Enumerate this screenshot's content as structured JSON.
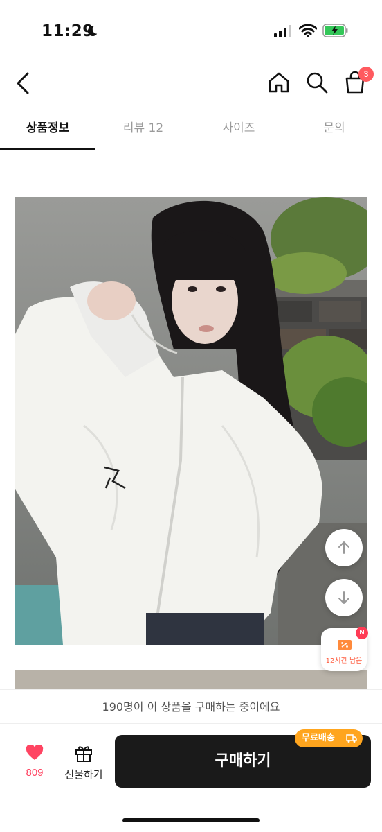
{
  "status_bar": {
    "time": "11:29"
  },
  "header": {
    "cart_count": "3"
  },
  "tabs": [
    {
      "label": "상품정보",
      "active": true
    },
    {
      "label": "리뷰 12",
      "active": false
    },
    {
      "label": "사이즈",
      "active": false
    },
    {
      "label": "문의",
      "active": false
    }
  ],
  "coupon": {
    "text": "12시간 남음",
    "badge": "N"
  },
  "notice": {
    "text": "190명이 이 상품을 구매하는 중이에요"
  },
  "bottom": {
    "like_count": "809",
    "gift_label": "선물하기",
    "buy_label": "구매하기",
    "free_shipping_label": "무료배송"
  },
  "colors": {
    "accent_red": "#ff4462",
    "badge_red": "#ff5a5f",
    "shipping_orange": "#ffa51e",
    "buy_button": "#1a1a1a"
  }
}
